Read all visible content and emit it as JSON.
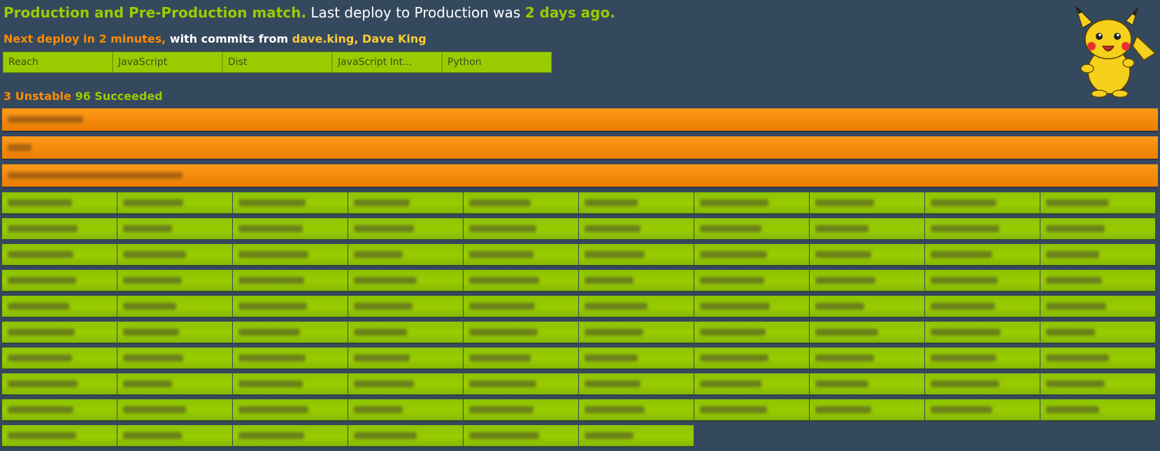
{
  "header": {
    "status_ok": "Production and Pre-Production match.",
    "status_last": "Last deploy to Production was",
    "status_ago": "2 days ago."
  },
  "deploy": {
    "next": "Next deploy in 2 minutes,",
    "with_commits": "with commits from",
    "user": "dave.king,",
    "name": "Dave King"
  },
  "tabs": [
    "Reach",
    "JavaScript",
    "Dist",
    "JavaScript Int...",
    "Python"
  ],
  "summary": {
    "unstable_count": "3",
    "unstable_label": "Unstable",
    "succeeded_count": "96",
    "succeeded_label": "Succeeded"
  },
  "colors": {
    "background": "#34495e",
    "success": "#99cc00",
    "unstable": "#ff8c00"
  },
  "icons": {
    "mascot": "pikachu-icon"
  }
}
